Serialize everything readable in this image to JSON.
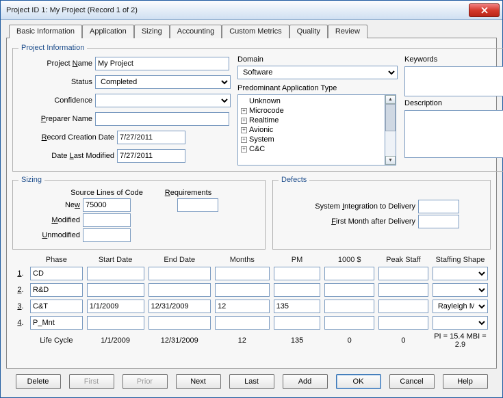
{
  "titlebar": {
    "title": "Project ID 1:    My Project    (Record 1 of 2)"
  },
  "tabs": [
    {
      "label": "Basic Information",
      "active": true
    },
    {
      "label": "Application"
    },
    {
      "label": "Sizing"
    },
    {
      "label": "Accounting"
    },
    {
      "label": "Custom Metrics"
    },
    {
      "label": "Quality"
    },
    {
      "label": "Review"
    }
  ],
  "project_info": {
    "legend": "Project Information",
    "project_name_label_pre": "Project ",
    "project_name_label_u": "N",
    "project_name_label_post": "ame",
    "project_name": "My Project",
    "status_label": "Status",
    "status_value": "Completed",
    "confidence_label": "Confidence",
    "confidence_value": "",
    "preparer_label_u": "P",
    "preparer_label_post": "reparer Name",
    "preparer_value": "",
    "record_created_label_u": "R",
    "record_created_label_post": "ecord Creation Date",
    "record_created_value": "7/27/2011",
    "date_modified_label_pre": "Date ",
    "date_modified_label_u": "L",
    "date_modified_label_post": "ast Modified",
    "date_modified_value": "7/27/2011",
    "domain_label": "Domain",
    "domain_value": "Software",
    "app_type_label": "Predominant Application Type",
    "app_types": [
      "Unknown",
      "Microcode",
      "Realtime",
      "Avionic",
      "System",
      "C&C"
    ],
    "keywords_label": "Keywords",
    "keywords_value": "",
    "description_label": "Description",
    "description_value": ""
  },
  "sizing": {
    "legend": "Sizing",
    "sloc_header": "Source Lines of Code",
    "req_header_u": "R",
    "req_header_post": "equirements",
    "new_label_pre": "Ne",
    "new_label_u": "w",
    "new_value": "75000",
    "modified_label_u": "M",
    "modified_label_post": "odified",
    "modified_value": "",
    "unmodified_label_u": "U",
    "unmodified_label_post": "nmodified",
    "unmodified_value": "",
    "req_value": ""
  },
  "defects": {
    "legend": "Defects",
    "sys_label_pre": "System ",
    "sys_label_u": "I",
    "sys_label_post": "ntegration to Delivery",
    "sys_value": "",
    "first_label_u": "F",
    "first_label_post": "irst Month after Delivery",
    "first_value": ""
  },
  "phase_headers": {
    "phase": "Phase",
    "start": "Start Date",
    "end": "End Date",
    "months": "Months",
    "pm": "PM",
    "dollars": "1000 $",
    "peak": "Peak Staff",
    "shape": "Staffing Shape"
  },
  "phase_row_labels": {
    "r1_u": "1",
    "r1_post": ".",
    "r2_u": "2",
    "r2_post": ".",
    "r3_u": "3",
    "r3_post": ".",
    "r4_u": "4",
    "r4_post": "."
  },
  "phases": [
    {
      "phase": "CD",
      "start": "",
      "end": "",
      "months": "",
      "pm": "",
      "dollars": "",
      "peak": "",
      "shape": ""
    },
    {
      "phase": "R&D",
      "start": "",
      "end": "",
      "months": "",
      "pm": "",
      "dollars": "",
      "peak": "",
      "shape": ""
    },
    {
      "phase": "C&T",
      "start": "1/1/2009",
      "end": "12/31/2009",
      "months": "12",
      "pm": "135",
      "dollars": "",
      "peak": "",
      "shape": "Rayleigh Med Front Load"
    },
    {
      "phase": "P_Mnt",
      "start": "",
      "end": "",
      "months": "",
      "pm": "",
      "dollars": "",
      "peak": "",
      "shape": ""
    }
  ],
  "lifecycle": {
    "label": "Life Cycle",
    "start": "1/1/2009",
    "end": "12/31/2009",
    "months": "12",
    "pm": "135",
    "dollars": "0",
    "peak": "0",
    "pi_mbi": "PI = 15.4   MBI = 2.9"
  },
  "buttons": {
    "delete": "Delete",
    "first": "First",
    "prior": "Prior",
    "next": "Next",
    "last": "Last",
    "add": "Add",
    "ok": "OK",
    "cancel": "Cancel",
    "help": "Help"
  }
}
